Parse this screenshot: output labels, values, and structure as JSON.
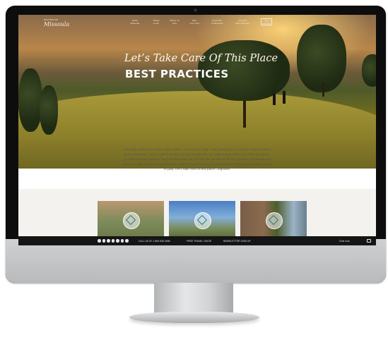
{
  "site": {
    "logo_small": "DESTINATION",
    "logo": "Missoula"
  },
  "nav": {
    "items": [
      {
        "line1": "About",
        "line2": "Missoula"
      },
      {
        "line1": "Things",
        "line2": "To Do"
      },
      {
        "line1": "Where To",
        "line2": "Stay"
      },
      {
        "line1": "Plan",
        "line2": "Your Visit"
      },
      {
        "line1": "Discounts",
        "line2": "In Missoula"
      },
      {
        "line1": "Connect",
        "line2": "With Missoula"
      }
    ],
    "cta": {
      "line1": "Find",
      "line2": "a Guide"
    }
  },
  "hero": {
    "script_title": "Let’s Take Care Of This Place",
    "title": "BEST PRACTICES"
  },
  "intro": {
    "text": "Missoula, Montana, is more than a place—it is a way of life. With wilderness to explore, stories rooted in the landscape, and a culture of cool, it’s no wonder that so many people fall in love with this place. In order to safeguard the “soul” in Missoula, we all must do our part to keep it vibrant, welcoming and weird for this and future generations. Whether you’re here for a weekend or a lifetime, you have a role to play. Let’s take care of this place—together."
  },
  "cards": [
    {
      "icon": "bike-icon"
    },
    {
      "icon": "mountain-icon"
    },
    {
      "icon": "people-icon"
    }
  ],
  "footer": {
    "social_icons": [
      "facebook-icon",
      "twitter-icon",
      "pinterest-icon",
      "instagram-icon",
      "youtube-icon",
      "flickr-icon",
      "rss-icon"
    ],
    "call_label": "CALL US AT 1.800.526.3465",
    "travel_guide_label": "FREE TRAVEL GUIDE",
    "newsletter_label": "NEWSLETTER SIGN UP",
    "chat_label": "Chat now"
  }
}
